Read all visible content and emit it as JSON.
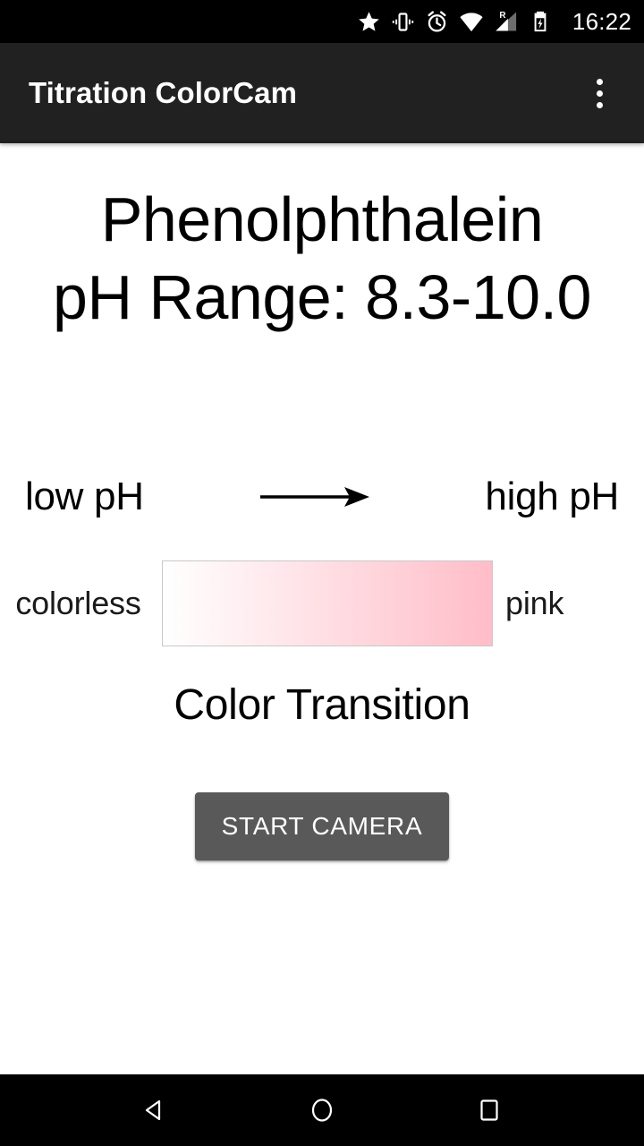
{
  "status_bar": {
    "background": "#000000",
    "time": "16:22",
    "icons": [
      {
        "name": "star-icon",
        "label": "priority-mode"
      },
      {
        "name": "vibrate-icon",
        "label": "vibrate-mode"
      },
      {
        "name": "alarm-icon",
        "label": "alarm-set"
      },
      {
        "name": "wifi-icon",
        "label": "wifi-connected"
      },
      {
        "name": "signal-roaming-icon",
        "label": "R"
      },
      {
        "name": "battery-charging-icon",
        "label": "charging"
      }
    ]
  },
  "app_bar": {
    "background": "#212121",
    "title": "Titration ColorCam",
    "overflow_label": "More options"
  },
  "main": {
    "background": "#ffffff",
    "indicator_name": "Phenolphthalein",
    "ph_range_text": "pH Range: 8.3-10.0",
    "ph_low_label": "low pH",
    "ph_high_label": "high pH",
    "arrow_icon": "right-arrow-icon",
    "color_low_label": "colorless",
    "color_high_label": "pink",
    "transition_caption": "Color Transition",
    "gradient": {
      "from": "#ffffff",
      "to": "#ffbdc8",
      "border": "#c9c9c9"
    },
    "start_camera_label": "START CAMERA",
    "button_color": "#595959"
  },
  "nav_bar": {
    "background": "#000000",
    "buttons": [
      {
        "name": "nav-back-button",
        "label": "Back"
      },
      {
        "name": "nav-home-button",
        "label": "Home"
      },
      {
        "name": "nav-recents-button",
        "label": "Recents"
      }
    ]
  }
}
